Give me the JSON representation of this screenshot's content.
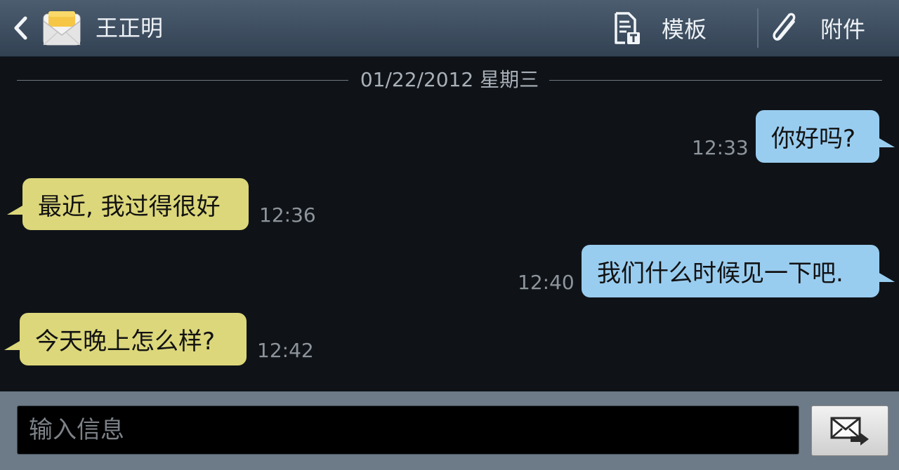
{
  "header": {
    "contact_name": "王正明",
    "template_label": "模板",
    "attach_label": "附件",
    "icons": {
      "back": "chevron-left-icon",
      "app": "envelope-icon",
      "template": "template-document-icon",
      "attach": "paperclip-icon"
    }
  },
  "conversation": {
    "date_divider": "01/22/2012 星期三",
    "messages": [
      {
        "direction": "outgoing",
        "text": "你好吗?",
        "time": "12:33"
      },
      {
        "direction": "incoming",
        "text": "最近, 我过得很好",
        "time": "12:36"
      },
      {
        "direction": "outgoing",
        "text": "我们什么时候见一下吧.",
        "time": "12:40"
      },
      {
        "direction": "incoming",
        "text": "今天晚上怎么样?",
        "time": "12:42"
      }
    ]
  },
  "composer": {
    "placeholder": "输入信息",
    "value": "",
    "send_icon": "send-message-icon"
  },
  "colors": {
    "header_bg": "#3e4f61",
    "outgoing_bubble": "#99cdf0",
    "incoming_bubble": "#dcd77a",
    "background": "#0f1318"
  }
}
